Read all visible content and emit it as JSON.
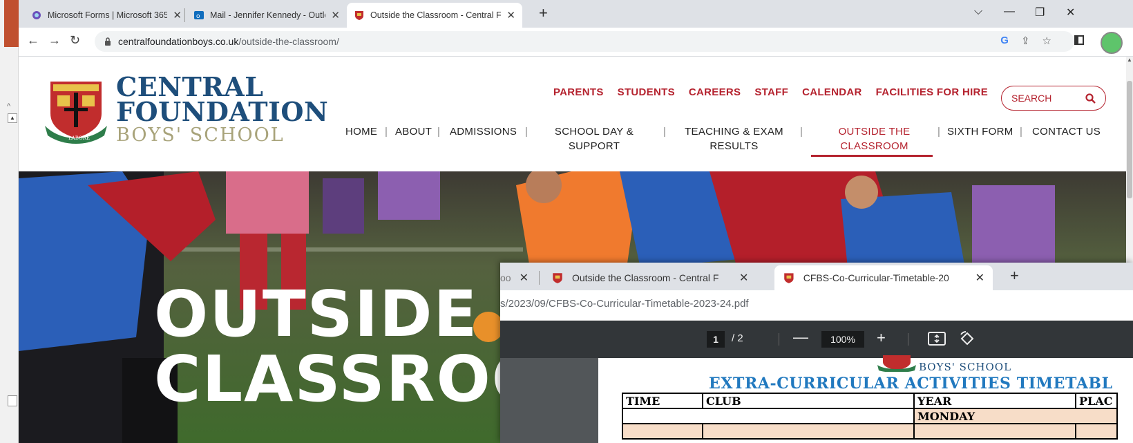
{
  "browser": {
    "tabs": [
      {
        "title": "Microsoft Forms | Microsoft 365",
        "active": false
      },
      {
        "title": "Mail - Jennifer Kennedy - Outloo",
        "active": false
      },
      {
        "title": "Outside the Classroom - Central F",
        "active": true
      }
    ],
    "new_tab": "+",
    "url_host": "centralfoundationboys.co.uk",
    "url_path": "/outside-the-classroom/",
    "window_controls": {
      "chevron": "⌵",
      "minimize": "—",
      "restore": "❐",
      "close": "✕"
    }
  },
  "site": {
    "logo": {
      "line1": "CENTRAL",
      "line2": "FOUNDATION",
      "line3": "BOYS' SCHOOL"
    },
    "top_nav": [
      "PARENTS",
      "STUDENTS",
      "CAREERS",
      "STAFF",
      "CALENDAR",
      "FACILITIES FOR HIRE"
    ],
    "search_label": "SEARCH",
    "main_nav": {
      "home": "HOME",
      "about": "ABOUT",
      "admissions": "ADMISSIONS",
      "school_day_1": "SCHOOL DAY &",
      "school_day_2": "SUPPORT",
      "teaching_1": "TEACHING & EXAM",
      "teaching_2": "RESULTS",
      "outside_1": "OUTSIDE THE",
      "outside_2": "CLASSROOM",
      "sixth_form": "SIXTH FORM",
      "contact": "CONTACT US"
    },
    "hero_title_1": "OUTSIDE T",
    "hero_title_2": "CLASSROO"
  },
  "pdf_window": {
    "tab_partial": "oo",
    "tabs": [
      {
        "title": "Outside the Classroom - Central F",
        "active": false
      },
      {
        "title": "CFBS-Co-Curricular-Timetable-20",
        "active": true
      }
    ],
    "url": "s/2023/09/CFBS-Co-Curricular-Timetable-2023-24.pdf",
    "page_current": "1",
    "page_total": "/ 2",
    "zoom": "100%",
    "doc": {
      "school": "BOYS' SCHOOL",
      "heading": "EXTRA-CURRICULAR ACTIVITIES TIMETABL",
      "table_header": [
        "TIME",
        "CLUB",
        "YEAR",
        "PLAC"
      ],
      "day_row": "MONDAY"
    }
  },
  "colors": {
    "brand_red": "#b5232f",
    "brand_blue": "#1e4e7b",
    "pdf_heading": "#2179bf"
  }
}
